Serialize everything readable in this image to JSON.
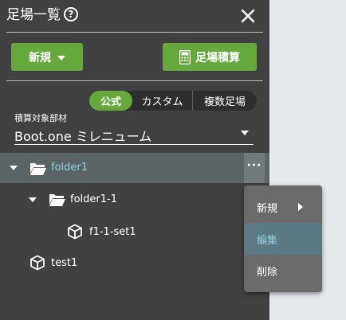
{
  "header": {
    "title": "足場一覧",
    "help_icon": "question-circle-icon",
    "help_glyph": "?",
    "close_icon": "close-icon"
  },
  "actions": {
    "new_label": "新規",
    "calc_label": "足場積算",
    "calc_icon": "calculator-icon"
  },
  "mode_tabs": [
    {
      "label": "公式",
      "active": true
    },
    {
      "label": "カスタム",
      "active": false
    },
    {
      "label": "複数足場",
      "active": false
    }
  ],
  "material": {
    "label": "積算対象部材",
    "value": "Boot.one ミレニューム"
  },
  "tree": [
    {
      "label": "folder1",
      "type": "folder",
      "expanded": true,
      "selected": true
    },
    {
      "label": "folder1-1",
      "type": "folder",
      "expanded": true,
      "selected": false
    },
    {
      "label": "f1-1-set1",
      "type": "set",
      "selected": false
    },
    {
      "label": "test1",
      "type": "set",
      "selected": false
    }
  ],
  "more_button": {
    "icon": "more-horizontal-icon",
    "glyph": "···"
  },
  "context_menu": {
    "items": [
      {
        "label": "新規",
        "has_submenu": true
      },
      {
        "label": "編集",
        "highlighted": true
      },
      {
        "label": "削除"
      }
    ]
  },
  "colors": {
    "panel": "#414141",
    "accent_green": "#67a83e",
    "selected_row": "#5a6466",
    "link_text": "#8fd2e0"
  }
}
